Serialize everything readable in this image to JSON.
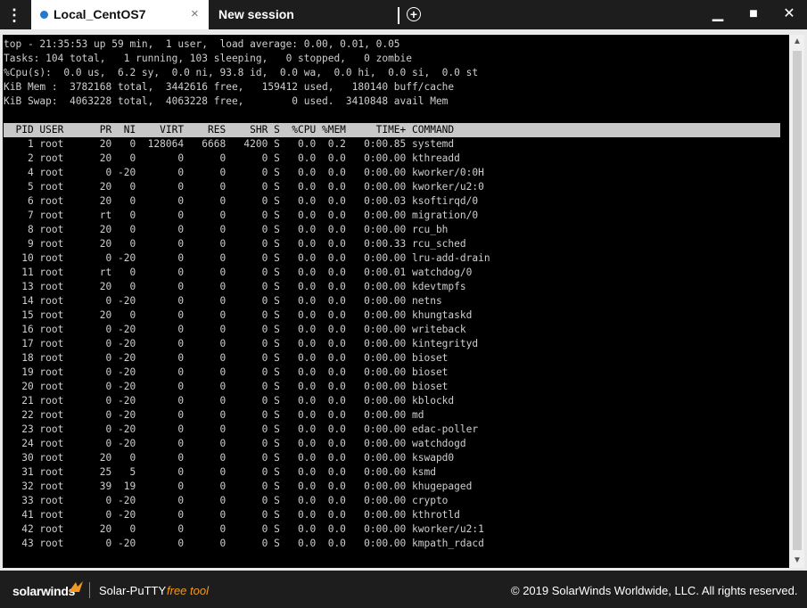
{
  "window": {
    "menu_glyph": "⋮",
    "tabs": [
      {
        "label": "Local_CentOS7",
        "close": "×"
      },
      {
        "label": "New session"
      }
    ],
    "add_glyph": "+",
    "minimize_glyph": "▁",
    "maximize_glyph": "■",
    "close_glyph": "✕"
  },
  "terminal": {
    "summary": [
      "top - 21:35:53 up 59 min,  1 user,  load average: 0.00, 0.01, 0.05",
      "Tasks: 104 total,   1 running, 103 sleeping,   0 stopped,   0 zombie",
      "%Cpu(s):  0.0 us,  6.2 sy,  0.0 ni, 93.8 id,  0.0 wa,  0.0 hi,  0.0 si,  0.0 st",
      "KiB Mem :  3782168 total,  3442616 free,   159412 used,   180140 buff/cache",
      "KiB Swap:  4063228 total,  4063228 free,        0 used.  3410848 avail Mem"
    ],
    "header": "  PID USER      PR  NI    VIRT    RES    SHR S  %CPU %MEM     TIME+ COMMAND",
    "processes": [
      "    1 root      20   0  128064   6668   4200 S   0.0  0.2   0:00.85 systemd",
      "    2 root      20   0       0      0      0 S   0.0  0.0   0:00.00 kthreadd",
      "    4 root       0 -20       0      0      0 S   0.0  0.0   0:00.00 kworker/0:0H",
      "    5 root      20   0       0      0      0 S   0.0  0.0   0:00.00 kworker/u2:0",
      "    6 root      20   0       0      0      0 S   0.0  0.0   0:00.03 ksoftirqd/0",
      "    7 root      rt   0       0      0      0 S   0.0  0.0   0:00.00 migration/0",
      "    8 root      20   0       0      0      0 S   0.0  0.0   0:00.00 rcu_bh",
      "    9 root      20   0       0      0      0 S   0.0  0.0   0:00.33 rcu_sched",
      "   10 root       0 -20       0      0      0 S   0.0  0.0   0:00.00 lru-add-drain",
      "   11 root      rt   0       0      0      0 S   0.0  0.0   0:00.01 watchdog/0",
      "   13 root      20   0       0      0      0 S   0.0  0.0   0:00.00 kdevtmpfs",
      "   14 root       0 -20       0      0      0 S   0.0  0.0   0:00.00 netns",
      "   15 root      20   0       0      0      0 S   0.0  0.0   0:00.00 khungtaskd",
      "   16 root       0 -20       0      0      0 S   0.0  0.0   0:00.00 writeback",
      "   17 root       0 -20       0      0      0 S   0.0  0.0   0:00.00 kintegrityd",
      "   18 root       0 -20       0      0      0 S   0.0  0.0   0:00.00 bioset",
      "   19 root       0 -20       0      0      0 S   0.0  0.0   0:00.00 bioset",
      "   20 root       0 -20       0      0      0 S   0.0  0.0   0:00.00 bioset",
      "   21 root       0 -20       0      0      0 S   0.0  0.0   0:00.00 kblockd",
      "   22 root       0 -20       0      0      0 S   0.0  0.0   0:00.00 md",
      "   23 root       0 -20       0      0      0 S   0.0  0.0   0:00.00 edac-poller",
      "   24 root       0 -20       0      0      0 S   0.0  0.0   0:00.00 watchdogd",
      "   30 root      20   0       0      0      0 S   0.0  0.0   0:00.00 kswapd0",
      "   31 root      25   5       0      0      0 S   0.0  0.0   0:00.00 ksmd",
      "   32 root      39  19       0      0      0 S   0.0  0.0   0:00.00 khugepaged",
      "   33 root       0 -20       0      0      0 S   0.0  0.0   0:00.00 crypto",
      "   41 root       0 -20       0      0      0 S   0.0  0.0   0:00.00 kthrotld",
      "   42 root      20   0       0      0      0 S   0.0  0.0   0:00.00 kworker/u2:1",
      "   43 root       0 -20       0      0      0 S   0.0  0.0   0:00.00 kmpath_rdacd"
    ]
  },
  "scrollbar": {
    "up_glyph": "▲",
    "down_glyph": "▼"
  },
  "footer": {
    "brand": "solarwinds",
    "product": "Solar-PuTTY",
    "tagline": "free tool",
    "copyright": "© 2019 SolarWinds Worldwide, LLC. All rights reserved."
  },
  "colors": {
    "accent": "#1f7bd1",
    "orange": "#f39a1e"
  }
}
